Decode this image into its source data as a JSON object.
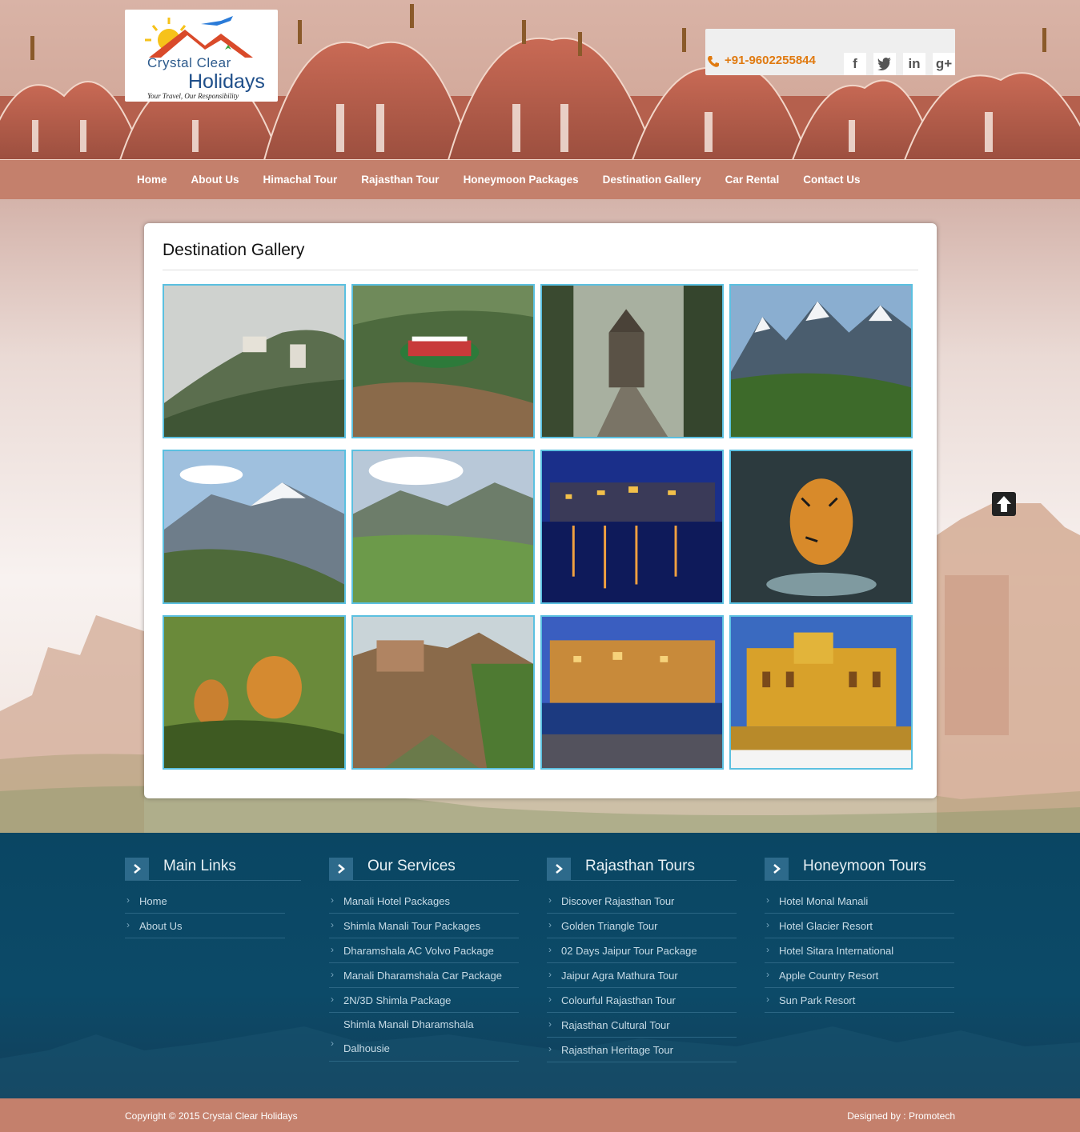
{
  "logo": {
    "brand_top": "Crystal Clear",
    "brand_main": "Holidays",
    "tagline": "Your Travel, Our Responsibility"
  },
  "contact": {
    "phone": "+91-9602255844",
    "social_icons": [
      "facebook-icon",
      "twitter-icon",
      "linkedin-icon",
      "google-plus-icon"
    ]
  },
  "nav": {
    "items": [
      "Home",
      "About Us",
      "Himachal Tour",
      "Rajasthan Tour",
      "Honeymoon Packages",
      "Destination Gallery",
      "Car Rental",
      "Contact Us"
    ]
  },
  "gallery": {
    "title": "Destination Gallery",
    "thumbnails": [
      "misty-hill-town",
      "cricket-stadium-valley",
      "church-in-forest",
      "snow-mountain-village",
      "hill-town-snow-peaks",
      "green-valley-mountains",
      "lake-palace-night",
      "tiger-in-water",
      "tigers-in-grass",
      "fort-on-cliff",
      "city-palace-lake-dusk",
      "amber-fort"
    ]
  },
  "footer": {
    "columns": [
      {
        "title": "Main Links",
        "links": [
          "Home",
          "About Us"
        ]
      },
      {
        "title": "Our Services",
        "links": [
          "Manali Hotel Packages",
          "Shimla Manali Tour Packages",
          "Dharamshala AC Volvo Package",
          "Manali Dharamshala Car Package",
          "2N/3D Shimla Package",
          "Shimla Manali Dharamshala Dalhousie"
        ]
      },
      {
        "title": "Rajasthan Tours",
        "links": [
          "Discover Rajasthan Tour",
          "Golden Triangle Tour",
          "02 Days Jaipur Tour Package",
          "Jaipur Agra Mathura Tour",
          "Colourful Rajasthan Tour",
          "Rajasthan Cultural Tour",
          "Rajasthan Heritage Tour"
        ]
      },
      {
        "title": "Honeymoon Tours",
        "links": [
          "Hotel Monal Manali",
          "Hotel Glacier Resort",
          "Hotel Sitara International",
          "Apple Country Resort",
          "Sun Park Resort"
        ]
      }
    ],
    "copyright": "Copyright © 2015 Crystal Clear Holidays",
    "designed_by": "Designed by : Promotech"
  },
  "colors": {
    "nav_bg": "#c4806c",
    "footer_bg": "#0a4663",
    "phone": "#e07a10",
    "thumb_border": "#5bc0e0"
  }
}
